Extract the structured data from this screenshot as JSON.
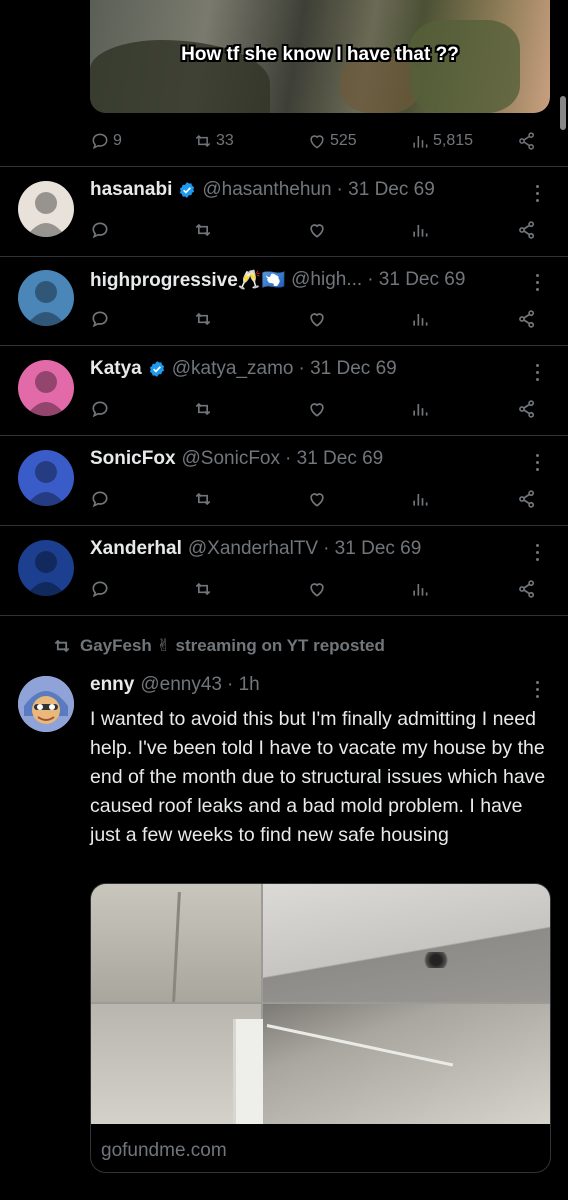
{
  "top_tweet": {
    "caption": "How tf she know I have that ??",
    "replies": "9",
    "reposts": "33",
    "likes": "525",
    "views": "5,815"
  },
  "replies_list": [
    {
      "name": "hasanabi",
      "verified": true,
      "handle": "@hasanthehun",
      "date": "· 31 Dec 69",
      "avatar_color": "#e8e2da"
    },
    {
      "name": "highprogressive🥂🇦🇶",
      "verified": false,
      "handle": "@high...",
      "date": "· 31 Dec 69",
      "avatar_color": "#4a86b8"
    },
    {
      "name": "Katya",
      "verified": true,
      "handle": "@katya_zamo",
      "date": "· 31 Dec 69",
      "avatar_color": "#e26aa8"
    },
    {
      "name": "SonicFox",
      "verified": false,
      "handle": "@SonicFox",
      "date": "· 31 Dec 69",
      "avatar_color": "#3a5cc8"
    },
    {
      "name": "Xanderhal",
      "verified": false,
      "handle": "@XanderhalTV",
      "date": "· 31 Dec 69",
      "avatar_color": "#1d3f8f"
    }
  ],
  "repost": {
    "label": "GayFesh ✌ streaming on YT reposted"
  },
  "main_tweet": {
    "name": "enny",
    "handle": "@enny43",
    "time": "· 1h",
    "text": "I wanted to avoid this but I'm finally admitting I need help. I've been told I have to vacate my house by the end of the month due to structural issues which have caused roof leaks and a bad mold problem. I have just a few weeks to find new safe housing",
    "card_domain": "gofundme.com"
  },
  "colors": {
    "background": "#000000",
    "text": "#e7e9ea",
    "muted": "#71767b",
    "verified": "#1d9bf0",
    "divider": "#2f3336"
  }
}
